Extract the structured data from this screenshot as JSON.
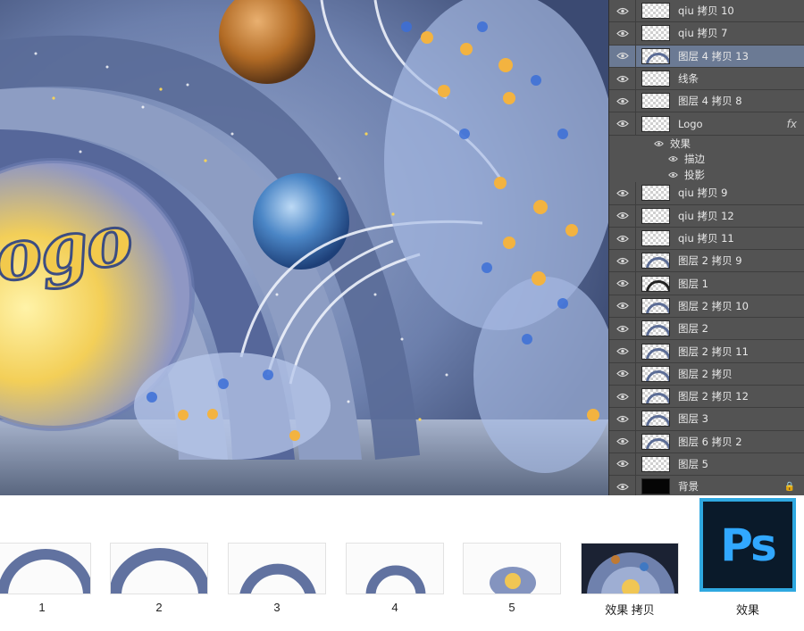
{
  "canvas": {
    "logo_text": "ogo"
  },
  "layers_panel": {
    "layers": [
      {
        "name": "qiu 拷贝 10",
        "thumb": "checker",
        "visible": true,
        "selected": false
      },
      {
        "name": "qiu 拷贝 7",
        "thumb": "checker",
        "visible": true,
        "selected": false
      },
      {
        "name": "图层 4 拷贝 13",
        "thumb": "arc",
        "visible": true,
        "selected": true
      },
      {
        "name": "线条",
        "thumb": "checker",
        "visible": true,
        "selected": false
      },
      {
        "name": "图层 4 拷贝 8",
        "thumb": "checker",
        "visible": true,
        "selected": false
      },
      {
        "name": "Logo",
        "thumb": "checker",
        "visible": true,
        "selected": false,
        "fx": "fx"
      }
    ],
    "effects": {
      "label": "效果",
      "items": [
        "描边",
        "投影"
      ]
    },
    "layers_after": [
      {
        "name": "qiu 拷贝 9",
        "thumb": "checker"
      },
      {
        "name": "qiu 拷贝 12",
        "thumb": "checker"
      },
      {
        "name": "qiu 拷贝 11",
        "thumb": "checker"
      },
      {
        "name": "图层 2 拷贝 9",
        "thumb": "arc"
      },
      {
        "name": "图层 1",
        "thumb": "dark"
      },
      {
        "name": "图层 2 拷贝 10",
        "thumb": "arc"
      },
      {
        "name": "图层 2",
        "thumb": "arc"
      },
      {
        "name": "图层 2 拷贝 11",
        "thumb": "arc"
      },
      {
        "name": "图层 2 拷贝",
        "thumb": "arc"
      },
      {
        "name": "图层 2 拷贝 12",
        "thumb": "arc"
      },
      {
        "name": "图层 3",
        "thumb": "arc"
      },
      {
        "name": "图层 6 拷贝 2",
        "thumb": "arc"
      },
      {
        "name": "图层 5",
        "thumb": "checker"
      },
      {
        "name": "背景",
        "thumb": "solid-black",
        "locked": true
      }
    ]
  },
  "steps": [
    {
      "label": "1"
    },
    {
      "label": "2"
    },
    {
      "label": "3"
    },
    {
      "label": "4"
    },
    {
      "label": "5"
    },
    {
      "label": "效果 拷贝"
    }
  ],
  "final": {
    "label": "效果",
    "ps_text": "Ps"
  },
  "colors": {
    "panel_bg": "#535353",
    "selected_row": "#6b7a94",
    "ps_blue": "#31a8ff"
  }
}
